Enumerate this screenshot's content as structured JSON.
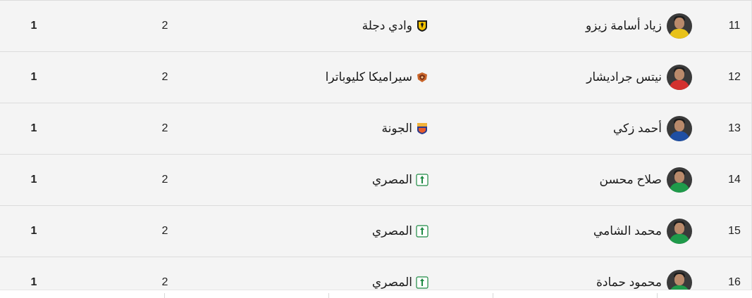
{
  "table": {
    "rows": [
      {
        "rank": "11",
        "player": "زياد أسامة زيزو",
        "team": "وادي دجلة",
        "team_logo": "wadi-degla-logo",
        "shirt_color": "#e8c21a",
        "col_a": "2",
        "col_b": "1"
      },
      {
        "rank": "12",
        "player": "نيتس جراديشار",
        "team": "سيراميكا كليوباترا",
        "team_logo": "ceramica-cleopatra-logo",
        "shirt_color": "#d3312f",
        "col_a": "2",
        "col_b": "1"
      },
      {
        "rank": "13",
        "player": "أحمد زكي",
        "team": "الجونة",
        "team_logo": "el-gouna-logo",
        "shirt_color": "#1f4fa3",
        "col_a": "2",
        "col_b": "1"
      },
      {
        "rank": "14",
        "player": "صلاح محسن",
        "team": "المصري",
        "team_logo": "al-masry-logo",
        "shirt_color": "#1f9a4a",
        "col_a": "2",
        "col_b": "1"
      },
      {
        "rank": "15",
        "player": "محمد الشامي",
        "team": "المصري",
        "team_logo": "al-masry-logo",
        "shirt_color": "#1f9a4a",
        "col_a": "2",
        "col_b": "1"
      },
      {
        "rank": "16",
        "player": "محمود حمادة",
        "team": "المصري",
        "team_logo": "al-masry-logo",
        "shirt_color": "#1f9a4a",
        "col_a": "2",
        "col_b": "1"
      }
    ]
  },
  "colors": {
    "row_bg": "#f4f4f4",
    "divider": "#dcdcdc",
    "text": "#1a1a1a"
  }
}
